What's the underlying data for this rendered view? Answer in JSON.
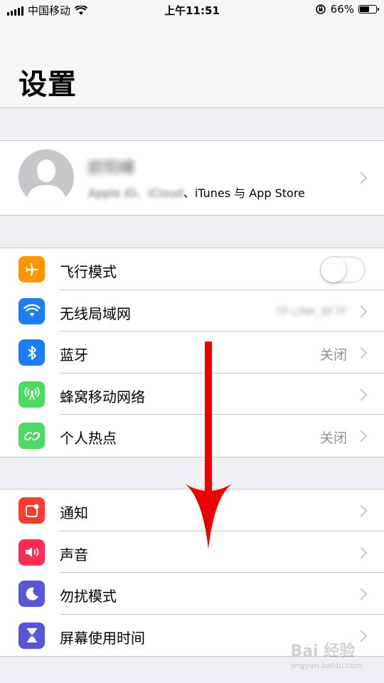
{
  "status_bar": {
    "carrier": "中国移动",
    "time": "上午11:51",
    "battery": "66%",
    "battery_level": 0.66
  },
  "header": {
    "title": "设置"
  },
  "profile": {
    "name": "欧阳峰",
    "subtitle_blurred": "Apple ID、iCloud",
    "subtitle_rest": "、iTunes 与 App Store"
  },
  "group1": [
    {
      "label": "飞行模式",
      "icon": "airplane-icon",
      "color": "#ff9500",
      "type": "toggle",
      "on": false
    },
    {
      "label": "无线局域网",
      "icon": "wifi-icon",
      "color": "#1e7cf5",
      "value": "TP-LINK_8F7F",
      "blurred": true
    },
    {
      "label": "蓝牙",
      "icon": "bluetooth-icon",
      "color": "#1e7cf5",
      "value": "关闭"
    },
    {
      "label": "蜂窝移动网络",
      "icon": "cellular-icon",
      "color": "#4cd964",
      "value": ""
    },
    {
      "label": "个人热点",
      "icon": "hotspot-icon",
      "color": "#4cd964",
      "value": "关闭"
    }
  ],
  "group2": [
    {
      "label": "通知",
      "icon": "notifications-icon",
      "color": "#ff3b30",
      "value": ""
    },
    {
      "label": "声音",
      "icon": "sound-icon",
      "color": "#ff2d55",
      "value": ""
    },
    {
      "label": "勿扰模式",
      "icon": "moon-icon",
      "color": "#5856d6",
      "value": ""
    },
    {
      "label": "屏幕使用时间",
      "icon": "hourglass-icon",
      "color": "#5856d6",
      "value": ""
    }
  ],
  "watermark": {
    "brand": "Bai 经验",
    "url": "jingyan.baidu.com"
  }
}
